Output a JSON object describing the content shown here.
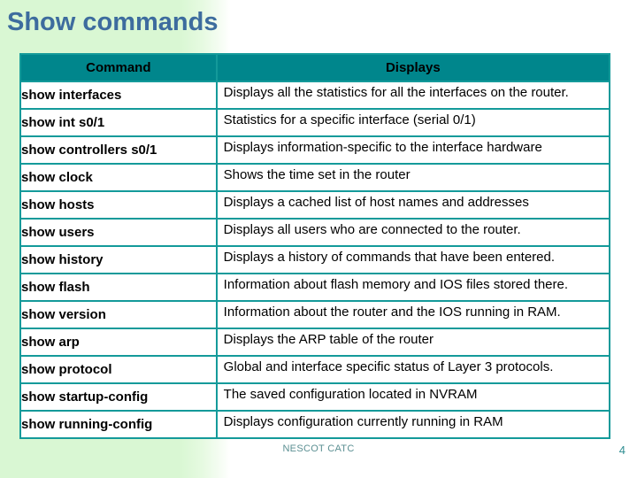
{
  "slide": {
    "title": "Show commands",
    "title_color": "#3d6c9e",
    "accent_color": "#00868c",
    "border_color": "#149a9a",
    "panel_color": "#d9f7d3"
  },
  "table": {
    "headers": [
      "Command",
      "Displays"
    ],
    "rows": [
      {
        "command": "show interfaces",
        "displays": "Displays all the statistics for all the interfaces on the router."
      },
      {
        "command": "show int s0/1",
        "displays": "Statistics for a specific interface (serial 0/1)"
      },
      {
        "command": "show controllers s0/1",
        "displays": "Displays information-specific to the interface hardware"
      },
      {
        "command": "show clock",
        "displays": "Shows the time set in the router"
      },
      {
        "command": "show hosts",
        "displays": "Displays a cached list of host names and addresses"
      },
      {
        "command": "show users",
        "displays": "Displays all users who are connected to the router."
      },
      {
        "command": "show history",
        "displays": "Displays a history of commands that have been entered."
      },
      {
        "command": "show flash",
        "displays": "Information about flash memory and  IOS files stored there."
      },
      {
        "command": "show version",
        "displays": "Information about the router and the IOS running in RAM."
      },
      {
        "command": "show arp",
        "displays": "Displays the ARP table of the router"
      },
      {
        "command": "show protocol",
        "displays": "Global and interface specific status of Layer 3 protocols."
      },
      {
        "command": "show startup-config",
        "displays": "The saved configuration located in NVRAM"
      },
      {
        "command": "show running-config",
        "displays": "Displays configuration currently running in RAM"
      }
    ]
  },
  "footer": {
    "credit": "NESCOT CATC",
    "page_number": "4"
  }
}
